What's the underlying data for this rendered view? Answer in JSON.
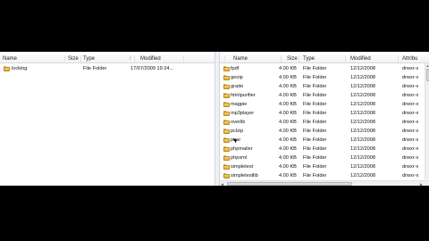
{
  "left_pane": {
    "columns": [
      "Name",
      "Size",
      "Type",
      "Modified"
    ],
    "rows": [
      {
        "name": "locking",
        "size": "",
        "type": "File Folder",
        "modified": "17/07/2009 19:24..."
      }
    ]
  },
  "right_pane": {
    "columns": [
      "Name",
      "Size",
      "Type",
      "Modified",
      "Attribu"
    ],
    "rows": [
      {
        "name": "fpdf",
        "size": "4.00 KB",
        "type": "File Folder",
        "modified": "12/12/2008",
        "attr": "drwxr-x"
      },
      {
        "name": "geoip",
        "size": "4.00 KB",
        "type": "File Folder",
        "modified": "12/12/2008",
        "attr": "drwxr-x"
      },
      {
        "name": "grade",
        "size": "4.00 KB",
        "type": "File Folder",
        "modified": "12/12/2008",
        "attr": "drwxr-x"
      },
      {
        "name": "htmlpurifier",
        "size": "4.00 KB",
        "type": "File Folder",
        "modified": "12/12/2008",
        "attr": "drwxr-x"
      },
      {
        "name": "magpie",
        "size": "4.00 KB",
        "type": "File Folder",
        "modified": "12/12/2008",
        "attr": "drwxr-x"
      },
      {
        "name": "mp3player",
        "size": "4.00 KB",
        "type": "File Folder",
        "modified": "12/12/2008",
        "attr": "drwxr-x"
      },
      {
        "name": "overlib",
        "size": "4.00 KB",
        "type": "File Folder",
        "modified": "12/12/2008",
        "attr": "drwxr-x"
      },
      {
        "name": "pclzip",
        "size": "4.00 KB",
        "type": "File Folder",
        "modified": "12/12/2008",
        "attr": "drwxr-x"
      },
      {
        "name": "pear",
        "size": "4.00 KB",
        "type": "File Folder",
        "modified": "12/12/2008",
        "attr": "drwxr-x"
      },
      {
        "name": "phpmailer",
        "size": "4.00 KB",
        "type": "File Folder",
        "modified": "12/12/2008",
        "attr": "drwxr-x"
      },
      {
        "name": "phpxml",
        "size": "4.00 KB",
        "type": "File Folder",
        "modified": "12/12/2008",
        "attr": "drwxr-x"
      },
      {
        "name": "simpletest",
        "size": "4.00 KB",
        "type": "File Folder",
        "modified": "12/12/2008",
        "attr": "drwxr-x"
      },
      {
        "name": "simpletestlib",
        "size": "4.00 KB",
        "type": "File Folder",
        "modified": "12/12/2008",
        "attr": "drwxr-x"
      }
    ]
  }
}
